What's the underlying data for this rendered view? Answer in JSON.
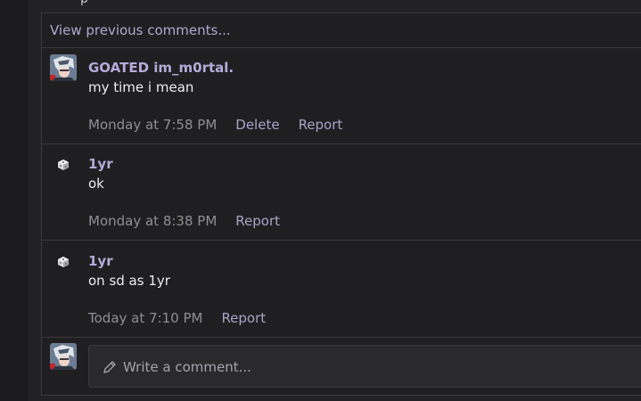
{
  "page": {
    "top_clipped_text": "p"
  },
  "comments_panel": {
    "view_previous_label": "View previous comments...",
    "comments": [
      {
        "author": "GOATED im_m0rtal.",
        "avatar": "anime-character-avatar",
        "text": "my time i mean",
        "timestamp": "Monday at 7:58 PM",
        "actions": [
          "Delete",
          "Report"
        ]
      },
      {
        "author": "1yr",
        "avatar": "default-dice-avatar",
        "text": "ok",
        "timestamp": "Monday at 8:38 PM",
        "actions": [
          "Report"
        ]
      },
      {
        "author": "1yr",
        "avatar": "default-dice-avatar",
        "text": "on sd as 1yr",
        "timestamp": "Today at 7:10 PM",
        "actions": [
          "Report"
        ]
      }
    ],
    "composer": {
      "avatar": "anime-character-avatar",
      "placeholder": "Write a comment...",
      "icon": "pencil-icon"
    }
  },
  "colors": {
    "accent_link": "#b0a8cf",
    "author_name": "#b4abd9",
    "body_text": "#ececef",
    "timestamp": "#8e8e96",
    "panel_bg": "#1f1f21",
    "border": "#3a3a3e"
  }
}
